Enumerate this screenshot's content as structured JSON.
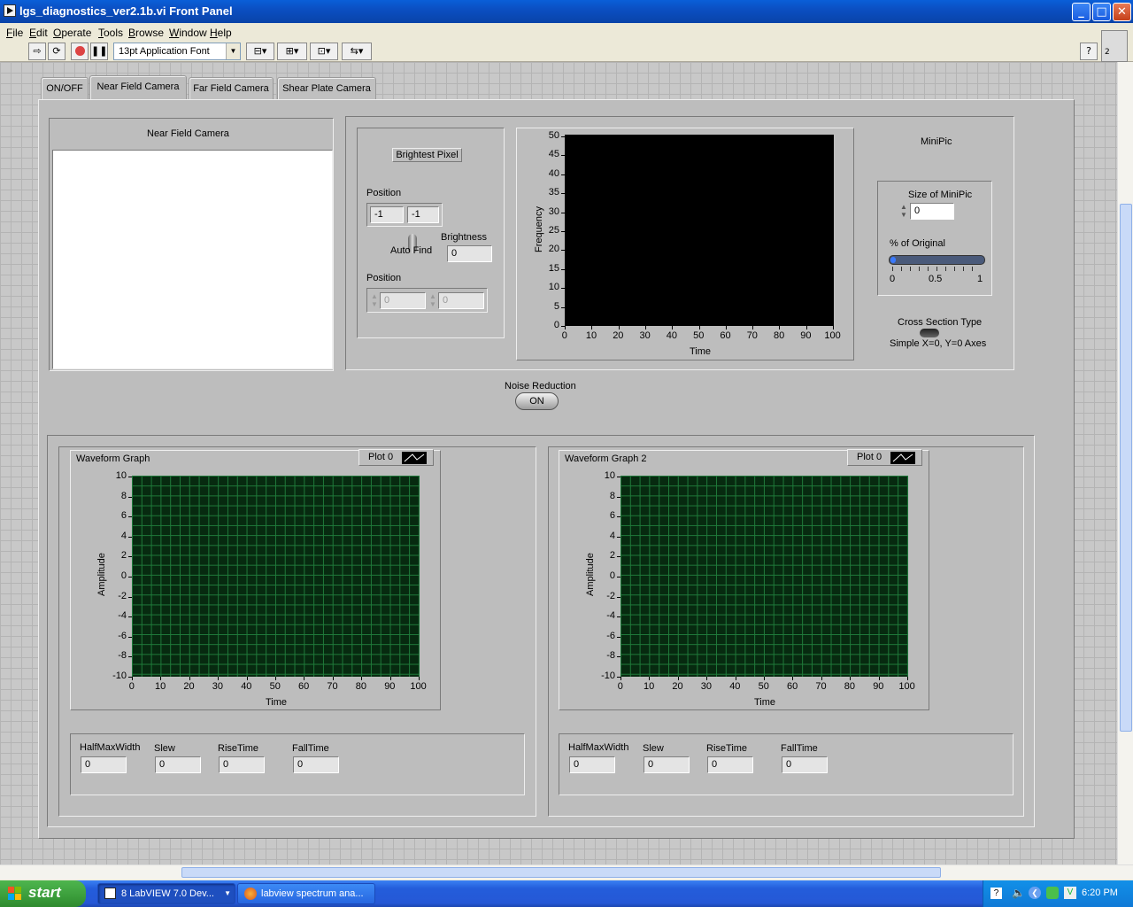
{
  "window": {
    "title": "lgs_diagnostics_ver2.1b.vi Front Panel",
    "min": "_",
    "max": "□",
    "close": "✕"
  },
  "menu": [
    "File",
    "Edit",
    "Operate",
    "Tools",
    "Browse",
    "Window",
    "Help"
  ],
  "toolbar": {
    "font": "13pt Application Font",
    "help": "?",
    "instance_badge": "2"
  },
  "tabs": [
    "ON/OFF",
    "Near Field Camera",
    "Far Field Camera",
    "Shear Plate Camera"
  ],
  "active_tab": "Near Field Camera",
  "near_field": {
    "title": "Near Field Camera"
  },
  "brightest": {
    "button": "Brightest Pixel",
    "position_label": "Position",
    "pos_x": "-1",
    "pos_y": "-1",
    "brightness_label": "Brightness",
    "brightness": "0",
    "autofind_label": "Auto Find",
    "position2_label": "Position",
    "pos2_x": "0",
    "pos2_y": "0"
  },
  "histogram": {
    "ylabel": "Frequency",
    "xlabel": "Time",
    "yticks": [
      "50",
      "45",
      "40",
      "35",
      "30",
      "25",
      "20",
      "15",
      "10",
      "5",
      "0"
    ],
    "xticks": [
      "0",
      "10",
      "20",
      "30",
      "40",
      "50",
      "60",
      "70",
      "80",
      "90",
      "100"
    ]
  },
  "minipic": {
    "title": "MiniPic",
    "size_label": "Size of MiniPic",
    "size": "0",
    "pct_label": "% of Original",
    "scale": [
      "0",
      "0.5",
      "1"
    ],
    "pct_value": 0,
    "cross_label": "Cross Section Type",
    "cross_value": "Simple X=0, Y=0 Axes"
  },
  "noise": {
    "label": "Noise Reduction",
    "button": "ON"
  },
  "graphs": [
    {
      "title": "Waveform Graph",
      "plot": "Plot 0",
      "ylabel": "Amplitude",
      "xlabel": "Time",
      "yticks": [
        "10",
        "8",
        "6",
        "4",
        "2",
        "0",
        "-2",
        "-4",
        "-6",
        "-8",
        "-10"
      ],
      "xticks": [
        "0",
        "10",
        "20",
        "30",
        "40",
        "50",
        "60",
        "70",
        "80",
        "90",
        "100"
      ],
      "stats": [
        {
          "label": "HalfMaxWidth",
          "value": "0"
        },
        {
          "label": "Slew",
          "value": "0"
        },
        {
          "label": "RiseTime",
          "value": "0"
        },
        {
          "label": "FallTime",
          "value": "0"
        }
      ]
    },
    {
      "title": "Waveform Graph 2",
      "plot": "Plot 0",
      "ylabel": "Amplitude",
      "xlabel": "Time",
      "yticks": [
        "10",
        "8",
        "6",
        "4",
        "2",
        "0",
        "-2",
        "-4",
        "-6",
        "-8",
        "-10"
      ],
      "xticks": [
        "0",
        "10",
        "20",
        "30",
        "40",
        "50",
        "60",
        "70",
        "80",
        "90",
        "100"
      ],
      "stats": [
        {
          "label": "HalfMaxWidth",
          "value": "0"
        },
        {
          "label": "Slew",
          "value": "0"
        },
        {
          "label": "RiseTime",
          "value": "0"
        },
        {
          "label": "FallTime",
          "value": "0"
        }
      ]
    }
  ],
  "taskbar": {
    "start": "start",
    "items": [
      "8 LabVIEW 7.0 Dev...",
      "labview spectrum ana..."
    ],
    "clock": "6:20 PM"
  },
  "colors": {
    "titlebar": "#0a5fd8",
    "panel": "#bdbdbd",
    "plot_grid": "#1f7a3a",
    "taskbar": "#245ddb"
  }
}
